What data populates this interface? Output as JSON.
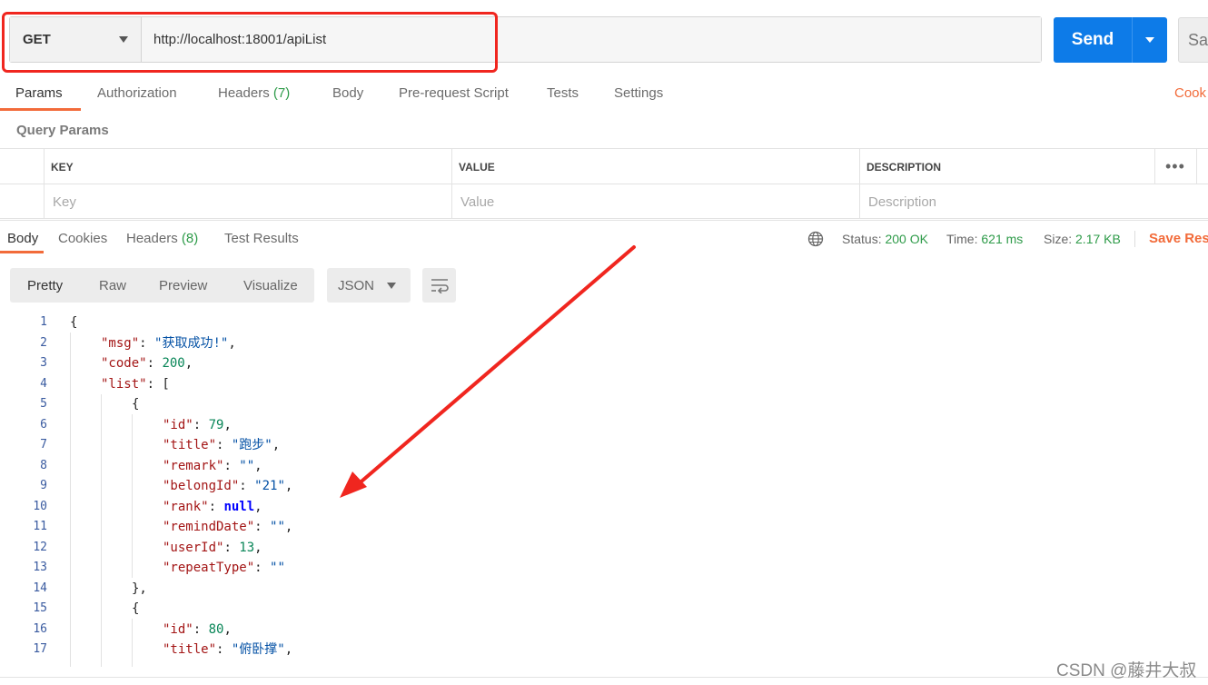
{
  "request": {
    "method": "GET",
    "url": "http://localhost:18001/apiList",
    "send_label": "Send",
    "save_label": "Sav"
  },
  "request_tabs": [
    {
      "label": "Params",
      "count": ""
    },
    {
      "label": "Authorization",
      "count": ""
    },
    {
      "label": "Headers",
      "count": "(7)"
    },
    {
      "label": "Body",
      "count": ""
    },
    {
      "label": "Pre-request Script",
      "count": ""
    },
    {
      "label": "Tests",
      "count": ""
    },
    {
      "label": "Settings",
      "count": ""
    }
  ],
  "cookies_link": "Cook",
  "query_params": {
    "title": "Query Params",
    "headers": [
      "KEY",
      "VALUE",
      "DESCRIPTION"
    ],
    "placeholders": [
      "Key",
      "Value",
      "Description"
    ],
    "more": "•••"
  },
  "response_tabs": [
    {
      "label": "Body",
      "count": ""
    },
    {
      "label": "Cookies",
      "count": ""
    },
    {
      "label": "Headers",
      "count": "(8)"
    },
    {
      "label": "Test Results",
      "count": ""
    }
  ],
  "response_status": {
    "status_label": "Status:",
    "status_value": "200 OK",
    "time_label": "Time:",
    "time_value": "621 ms",
    "size_label": "Size:",
    "size_value": "2.17 KB",
    "save_response": "Save Resp"
  },
  "view_modes": [
    "Pretty",
    "Raw",
    "Preview",
    "Visualize"
  ],
  "format": "JSON",
  "code_lines": [
    {
      "n": "1",
      "indent": 0,
      "parts": [
        [
          "p",
          "{"
        ]
      ]
    },
    {
      "n": "2",
      "indent": 1,
      "parts": [
        [
          "k",
          "\"msg\""
        ],
        [
          "p",
          ": "
        ],
        [
          "s",
          "\"获取成功!\""
        ],
        [
          "p",
          ","
        ]
      ]
    },
    {
      "n": "3",
      "indent": 1,
      "parts": [
        [
          "k",
          "\"code\""
        ],
        [
          "p",
          ": "
        ],
        [
          "n",
          "200"
        ],
        [
          "p",
          ","
        ]
      ]
    },
    {
      "n": "4",
      "indent": 1,
      "parts": [
        [
          "k",
          "\"list\""
        ],
        [
          "p",
          ": ["
        ]
      ]
    },
    {
      "n": "5",
      "indent": 2,
      "parts": [
        [
          "p",
          "{"
        ]
      ]
    },
    {
      "n": "6",
      "indent": 3,
      "parts": [
        [
          "k",
          "\"id\""
        ],
        [
          "p",
          ": "
        ],
        [
          "n",
          "79"
        ],
        [
          "p",
          ","
        ]
      ]
    },
    {
      "n": "7",
      "indent": 3,
      "parts": [
        [
          "k",
          "\"title\""
        ],
        [
          "p",
          ": "
        ],
        [
          "s",
          "\"跑步\""
        ],
        [
          "p",
          ","
        ]
      ]
    },
    {
      "n": "8",
      "indent": 3,
      "parts": [
        [
          "k",
          "\"remark\""
        ],
        [
          "p",
          ": "
        ],
        [
          "s",
          "\"\""
        ],
        [
          "p",
          ","
        ]
      ]
    },
    {
      "n": "9",
      "indent": 3,
      "parts": [
        [
          "k",
          "\"belongId\""
        ],
        [
          "p",
          ": "
        ],
        [
          "s",
          "\"21\""
        ],
        [
          "p",
          ","
        ]
      ]
    },
    {
      "n": "10",
      "indent": 3,
      "parts": [
        [
          "k",
          "\"rank\""
        ],
        [
          "p",
          ": "
        ],
        [
          "kw",
          "null"
        ],
        [
          "p",
          ","
        ]
      ]
    },
    {
      "n": "11",
      "indent": 3,
      "parts": [
        [
          "k",
          "\"remindDate\""
        ],
        [
          "p",
          ": "
        ],
        [
          "s",
          "\"\""
        ],
        [
          "p",
          ","
        ]
      ]
    },
    {
      "n": "12",
      "indent": 3,
      "parts": [
        [
          "k",
          "\"userId\""
        ],
        [
          "p",
          ": "
        ],
        [
          "n",
          "13"
        ],
        [
          "p",
          ","
        ]
      ]
    },
    {
      "n": "13",
      "indent": 3,
      "parts": [
        [
          "k",
          "\"repeatType\""
        ],
        [
          "p",
          ": "
        ],
        [
          "s",
          "\"\""
        ]
      ]
    },
    {
      "n": "14",
      "indent": 2,
      "parts": [
        [
          "p",
          "},"
        ]
      ]
    },
    {
      "n": "15",
      "indent": 2,
      "parts": [
        [
          "p",
          "{"
        ]
      ]
    },
    {
      "n": "16",
      "indent": 3,
      "parts": [
        [
          "k",
          "\"id\""
        ],
        [
          "p",
          ": "
        ],
        [
          "n",
          "80"
        ],
        [
          "p",
          ","
        ]
      ]
    },
    {
      "n": "17",
      "indent": 3,
      "parts": [
        [
          "k",
          "\"title\""
        ],
        [
          "p",
          ": "
        ],
        [
          "s",
          "\"俯卧撑\""
        ],
        [
          "p",
          ","
        ]
      ]
    }
  ],
  "watermark": "CSDN @藤井大叔",
  "colors": {
    "accent": "#f26b3a",
    "send": "#0d7be8",
    "annotation": "#f0261f",
    "success": "#2e9b49"
  }
}
